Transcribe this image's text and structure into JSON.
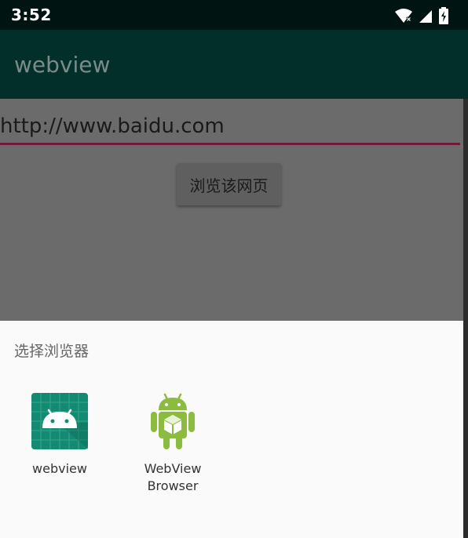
{
  "status_bar": {
    "time": "3:52",
    "icons": [
      "wifi-icon",
      "signal-icon",
      "battery-charging-icon"
    ]
  },
  "app_bar": {
    "title": "webview"
  },
  "content": {
    "url_value": "http://www.baidu.com",
    "browse_button_label": "浏览该网页"
  },
  "chooser": {
    "title": "选择浏览器",
    "apps": [
      {
        "label": "webview",
        "icon": "android-app-icon"
      },
      {
        "label": "WebView\nBrowser",
        "icon": "webview-browser-icon"
      }
    ]
  },
  "colors": {
    "status_bar": "#001411",
    "app_bar": "#022f2a",
    "scrim_content": "#6b6b6b",
    "url_underline": "#6e1b3b",
    "app_icon_bg": "#138a72"
  }
}
